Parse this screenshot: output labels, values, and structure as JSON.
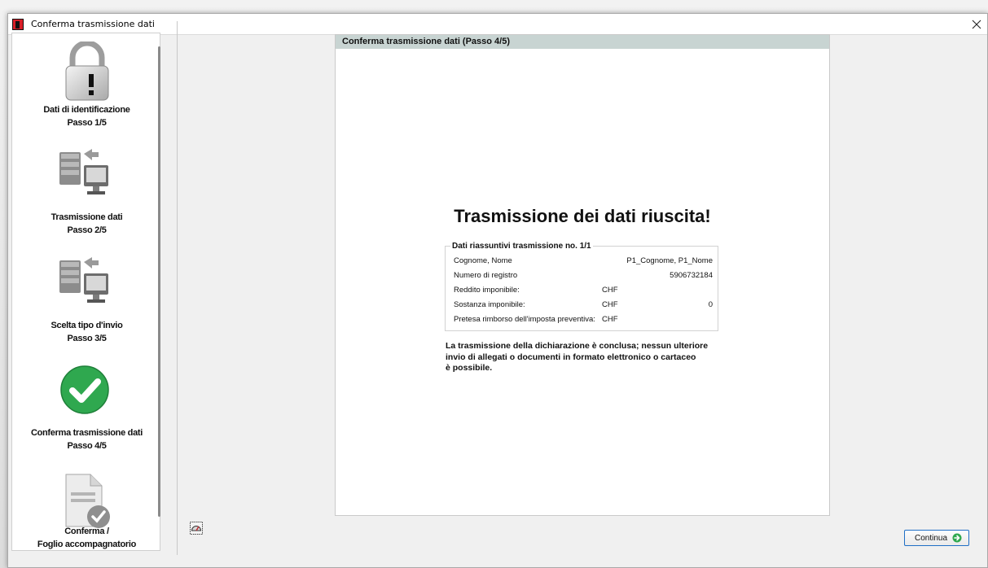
{
  "window": {
    "title": "Conferma trasmissione dati"
  },
  "sidebar": {
    "steps": [
      {
        "title": "Dati di identificazione",
        "subtitle": "Passo 1/5",
        "icon": "padlock-warning-icon"
      },
      {
        "title": "Trasmissione dati",
        "subtitle": "Passo 2/5",
        "icon": "server-transfer-icon"
      },
      {
        "title": "Scelta tipo d'invio",
        "subtitle": "Passo 3/5",
        "icon": "server-transfer-icon"
      },
      {
        "title": "Conferma trasmissione dati",
        "subtitle": "Passo 4/5",
        "icon": "green-check-icon"
      },
      {
        "title": "Conferma /",
        "subtitle": "Foglio accompagnatorio",
        "icon": "document-check-icon"
      }
    ]
  },
  "panel": {
    "header": "Conferma trasmissione dati (Passo 4/5)",
    "headline": "Trasmissione dei dati riuscita!",
    "summary": {
      "title": "Dati riassuntivi trasmissione no. 1/1",
      "rows": [
        {
          "label": "Cognome, Nome",
          "currency": "",
          "value": "P1_Cognome, P1_Nome"
        },
        {
          "label": "Numero di registro",
          "currency": "",
          "value": "5906732184"
        },
        {
          "label": "Reddito imponibile:",
          "currency": "CHF",
          "value": ""
        },
        {
          "label": "Sostanza imponibile:",
          "currency": "CHF",
          "value": "0"
        },
        {
          "label": "Pretesa rimborso dell'imposta preventiva:",
          "currency": "CHF",
          "value": ""
        }
      ]
    },
    "conclusion_lines": [
      "La trasmissione della dichiarazione è conclusa; nessun ulteriore",
      "invio di allegati o documenti in formato elettronico o cartaceo",
      "è possibile."
    ]
  },
  "footer": {
    "continue_label": "Continua"
  },
  "colors": {
    "panel_header": "#c8d4d2",
    "check_green": "#2fa84f",
    "button_border": "#1f6fc6"
  }
}
